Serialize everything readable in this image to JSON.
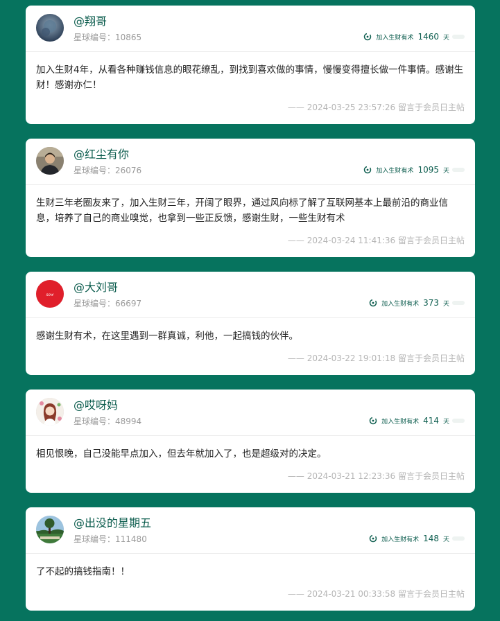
{
  "posts": [
    {
      "name": "@翔哥",
      "member_label": "星球编号：",
      "member_no": "10865",
      "days_label": "加入生财有术",
      "days": "1460",
      "days_unit": "天",
      "content": "加入生财4年，从看各种赚钱信息的眼花缭乱，到找到喜欢做的事情，慢慢变得擅长做一件事情。感谢生财！感谢亦仁！",
      "footer": "—— 2024-03-25 23:57:26 留言于会员日主帖"
    },
    {
      "name": "@红尘有你",
      "member_label": "星球编号：",
      "member_no": "26076",
      "days_label": "加入生财有术",
      "days": "1095",
      "days_unit": "天",
      "content": "生财三年老圈友来了，加入生财三年，开阔了眼界，通过风向标了解了互联网基本上最前沿的商业信息，培养了自己的商业嗅觉，也拿到一些正反馈，感谢生财，一些生财有术",
      "footer": "—— 2024-03-24 11:41:36 留言于会员日主帖"
    },
    {
      "name": "@大刘哥",
      "member_label": "星球编号：",
      "member_no": "66697",
      "days_label": "加入生财有术",
      "days": "373",
      "days_unit": "天",
      "content": "感谢生财有术，在这里遇到一群真诚，利他，一起搞钱的伙伴。",
      "footer": "—— 2024-03-22 19:01:18 留言于会员日主帖"
    },
    {
      "name": "@哎呀妈",
      "member_label": "星球编号：",
      "member_no": "48994",
      "days_label": "加入生财有术",
      "days": "414",
      "days_unit": "天",
      "content": "相见恨晚，自己没能早点加入，但去年就加入了，也是超级对的决定。",
      "footer": "—— 2024-03-21 12:23:36 留言于会员日主帖"
    },
    {
      "name": "@出没的星期五",
      "member_label": "星球编号：",
      "member_no": "111480",
      "days_label": "加入生财有术",
      "days": "148",
      "days_unit": "天",
      "content": "了不起的搞钱指南！！",
      "footer": "—— 2024-03-21 00:33:58 留言于会员日主帖"
    }
  ],
  "avatar_logo_text": "sow",
  "colors": {
    "background": "#06735e",
    "accent": "#0b5c4d",
    "muted": "#9a9a9a"
  },
  "icons": {
    "days": "clock-icon",
    "avatar": "avatar"
  }
}
